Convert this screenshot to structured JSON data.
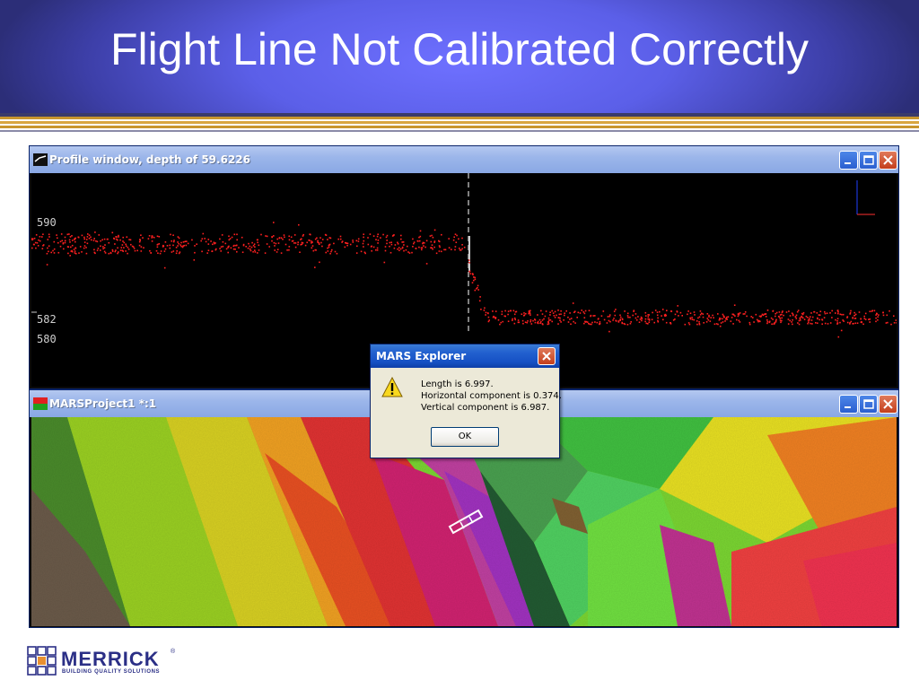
{
  "slide": {
    "title": "Flight Line Not Calibrated Correctly"
  },
  "profile_window": {
    "title": "Profile window, depth of 59.6226",
    "axis_labels": [
      "590",
      "582",
      "580"
    ]
  },
  "map_window": {
    "title": "MARSProject1 *:1"
  },
  "dialog": {
    "title": "MARS Explorer",
    "icon": "warning-icon",
    "lines": [
      "Length is 6.997.",
      "Horizontal component is 0.374.",
      "Vertical component is 6.987."
    ],
    "ok_label": "OK"
  },
  "logo": {
    "name": "MERRICK",
    "registered": "®",
    "tagline": "BUILDING QUALITY SOLUTIONS"
  },
  "colors": {
    "header_blue": "#5b5fe8",
    "stripe_gold": "#c8962e",
    "point_red": "#ff2020",
    "logo_navy": "#2b2f86"
  }
}
